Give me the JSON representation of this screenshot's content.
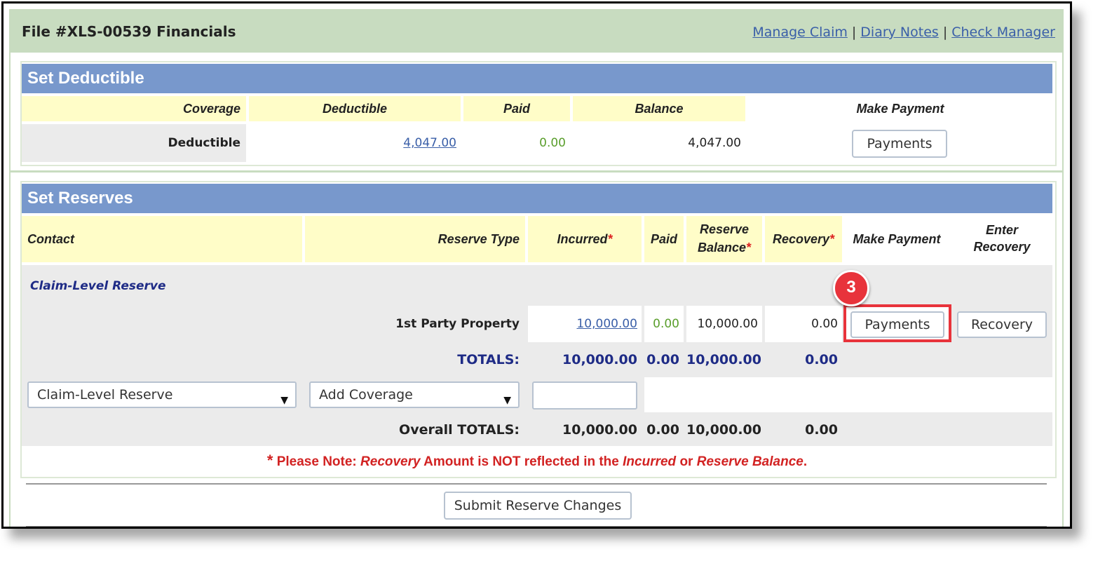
{
  "header": {
    "title": "File #XLS-00539 Financials",
    "links": [
      "Manage Claim",
      "Diary Notes",
      "Check Manager"
    ],
    "separator": "|"
  },
  "deductible": {
    "title": "Set Deductible",
    "columns": [
      "Coverage",
      "Deductible",
      "Paid",
      "Balance",
      "Make Payment"
    ],
    "row": {
      "coverage": "Deductible",
      "deductible": "4,047.00",
      "paid": "0.00",
      "balance": "4,047.00",
      "button": "Payments"
    }
  },
  "reserves": {
    "title": "Set Reserves",
    "columns": {
      "contact": "Contact",
      "reserve_type": "Reserve Type",
      "incurred": "Incurred",
      "paid": "Paid",
      "reserve_balance_l1": "Reserve",
      "reserve_balance_l2": "Balance",
      "recovery": "Recovery",
      "make_payment": "Make Payment",
      "enter_recovery_l1": "Enter",
      "enter_recovery_l2": "Recovery"
    },
    "required_marker": "*",
    "group_label": "Claim-Level Reserve",
    "row": {
      "reserve_type": "1st Party Property",
      "incurred": "10,000.00",
      "paid": "0.00",
      "reserve_balance": "10,000.00",
      "recovery": "0.00",
      "payment_button": "Payments",
      "recovery_button": "Recovery"
    },
    "totals": {
      "label": "TOTALS:",
      "incurred": "10,000.00",
      "paid": "0.00",
      "reserve_balance": "10,000.00",
      "recovery": "0.00"
    },
    "add_row": {
      "contact_select": "Claim-Level Reserve",
      "coverage_select": "Add Coverage",
      "amount_value": ""
    },
    "overall": {
      "label": "Overall TOTALS:",
      "incurred": "10,000.00",
      "paid": "0.00",
      "reserve_balance": "10,000.00",
      "recovery": "0.00"
    },
    "note": {
      "star": "*",
      "p1": "Please Note: ",
      "p2": "Recovery",
      "p3": " Amount is NOT reflected in the ",
      "p4": "Incurred",
      "p5": " or ",
      "p6": "Reserve Balance",
      "p7": "."
    }
  },
  "submit_button": "Submit Reserve Changes",
  "callout_number": "3",
  "colors": {
    "header_bg": "#c8dcc0",
    "section_title_bg": "#7898cc",
    "column_header_bg": "#fffdc8",
    "callout": "#e8333b",
    "link": "#3a5fa8",
    "totals": "#1e2b86",
    "note": "#d22222"
  }
}
